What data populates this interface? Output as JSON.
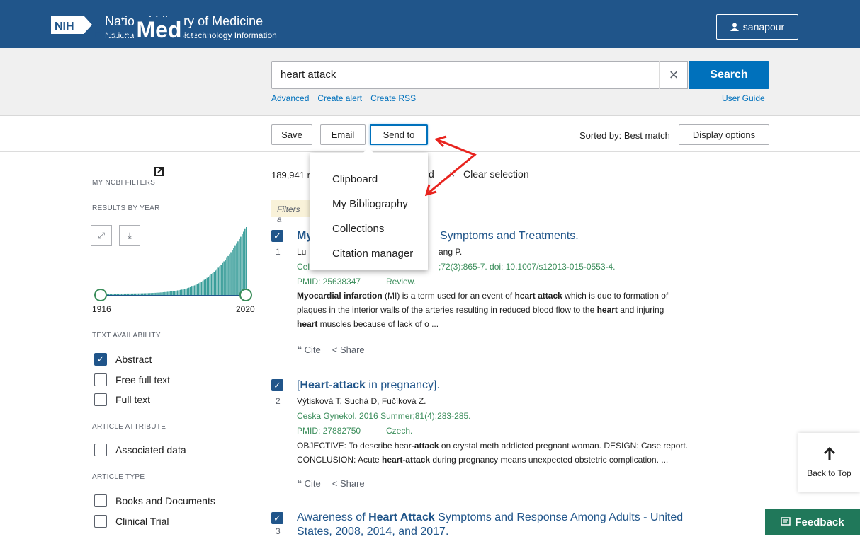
{
  "nih": {
    "title": "National Library of Medicine",
    "subtitle": "National Center for Biotechnology Information",
    "logo_text": "NIH"
  },
  "user": {
    "name": "sanapour"
  },
  "logo": {
    "pub": "Pub",
    "med": "Med",
    "gov": ".gov"
  },
  "search": {
    "value": "heart attack",
    "button": "Search",
    "links": [
      "Advanced",
      "Create alert",
      "Create RSS"
    ],
    "user_guide": "User Guide"
  },
  "actions": {
    "save": "Save",
    "email": "Email",
    "send_to": "Send to",
    "sorted_by": "Sorted by: Best match",
    "display_options": "Display options"
  },
  "send_to_menu": [
    "Clipboard",
    "My Bibliography",
    "Collections",
    "Citation manager"
  ],
  "sidebar": {
    "my_ncbi": "MY NCBI FILTERS",
    "results_by_year": "RESULTS BY YEAR",
    "year_start": "1916",
    "year_end": "2020",
    "text_availability": "TEXT AVAILABILITY",
    "abstract": "Abstract",
    "free_full": "Free full text",
    "full_text": "Full text",
    "article_attribute": "ARTICLE ATTRIBUTE",
    "associated": "Associated data",
    "article_type": "ARTICLE TYPE",
    "books": "Books and Documents",
    "clinical": "Clinical Trial"
  },
  "results": {
    "count": "189,941 r",
    "selected_frag": "d",
    "clear_selection": "Clear selection",
    "filters_applied": "Filters a"
  },
  "r1": {
    "num": "1",
    "title_frag": "My",
    "title_tail": "Symptoms and Treatments.",
    "auth_a": "Lu",
    "auth_b": "ang P.",
    "jour_a": "Cel",
    "jour_b": ";72(3):865-7. doi: 10.1007/s12013-015-0553-4.",
    "pmid": "PMID: 25638347",
    "type": "Review.",
    "snippet_1a": "Myocardial infarction",
    "snippet_1b": " (MI) is a term used for an event of ",
    "snippet_1c": "heart attack",
    "snippet_1d": " which is due to formation of",
    "snippet_2a": "plaques in the interior walls of the arteries resulting in reduced blood flow to the ",
    "snippet_2b": "heart",
    "snippet_2c": " and injuring",
    "snippet_3a": "heart",
    "snippet_3b": " muscles because of lack of o ..."
  },
  "r2": {
    "num": "2",
    "t1": "[",
    "t2": "Heart",
    "t3": "-",
    "t4": "attack",
    "t5": " in pregnancy].",
    "authors": "Výtisková T, Suchá D, Fučíková Z.",
    "journal": "Ceska Gynekol. 2016 Summer;81(4):283-285.",
    "pmid": "PMID: 27882750",
    "lang": "Czech.",
    "s1a": "OBJECTIVE: To describe hear-",
    "s1b": "attack",
    "s1c": " on crystal meth addicted pregnant woman. DESIGN: Case report.",
    "s2a": "CONCLUSION: Acute ",
    "s2b": "heart-attack",
    "s2c": " during pregnancy means unexpected obstetric complication. ..."
  },
  "r3": {
    "num": "3",
    "t1": "Awareness of ",
    "t2": "Heart Attack",
    "t3": " Symptoms and Response Among Adults - United",
    "t4": "States, 2008, 2014, and 2017."
  },
  "cite": "Cite",
  "share": "Share",
  "back_to_top": "Back to Top",
  "feedback": "Feedback",
  "colors": {
    "nih_blue": "#20558a",
    "search_blue": "#0071bc",
    "green": "#20785a",
    "annotation_red": "#e8231e"
  }
}
